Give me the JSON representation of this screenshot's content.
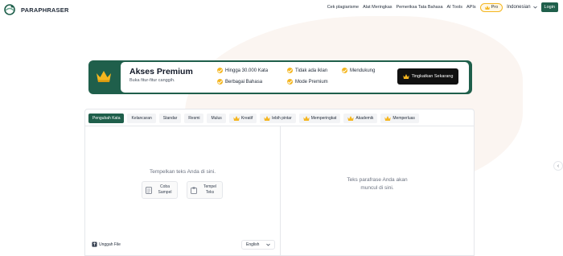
{
  "brand": {
    "name": "PARAPHRASER",
    "accent": "#1f5f4b",
    "gold": "#f5b61f"
  },
  "nav": {
    "links": [
      "Cek plagiarisme",
      "Alat Meringkas",
      "Pemeriksa Tata Bahasa",
      "AI Tools",
      "APIs"
    ],
    "pro_label": "Pro",
    "language": "Indonesian",
    "login_label": "Login"
  },
  "banner": {
    "title": "Akses Premium",
    "subtitle": "Buka fitur-fitur canggih.",
    "features": [
      "Hingga 30.000 Kata",
      "Tidak ada iklan",
      "Mendukung",
      "Berbagai Bahasa",
      "Mode Premium"
    ],
    "cta_label": "Tingkatkan Sekarang",
    "icon": "crown-icon"
  },
  "editor": {
    "modes": [
      {
        "label": "Pengubah Kata",
        "active": true,
        "premium": false
      },
      {
        "label": "Kelancaran",
        "active": false,
        "premium": false
      },
      {
        "label": "Standar",
        "active": false,
        "premium": false
      },
      {
        "label": "Resmi",
        "active": false,
        "premium": false
      },
      {
        "label": "Mulus",
        "active": false,
        "premium": false
      },
      {
        "label": "Kreatif",
        "active": false,
        "premium": true
      },
      {
        "label": "lebih pintar",
        "active": false,
        "premium": true
      },
      {
        "label": "Memperingkat",
        "active": false,
        "premium": true
      },
      {
        "label": "Akademik",
        "active": false,
        "premium": true
      },
      {
        "label": "Memperluas",
        "active": false,
        "premium": true
      }
    ],
    "input_placeholder": "Tempelkan teks Anda di sini.",
    "try_sample_label": "Coba Sampel",
    "paste_text_label": "Tempel Teks",
    "upload_label": "Unggah File",
    "language_value": "English",
    "output_placeholder_line1": "Teks parafrase Anda akan",
    "output_placeholder_line2": "muncul di sini."
  }
}
